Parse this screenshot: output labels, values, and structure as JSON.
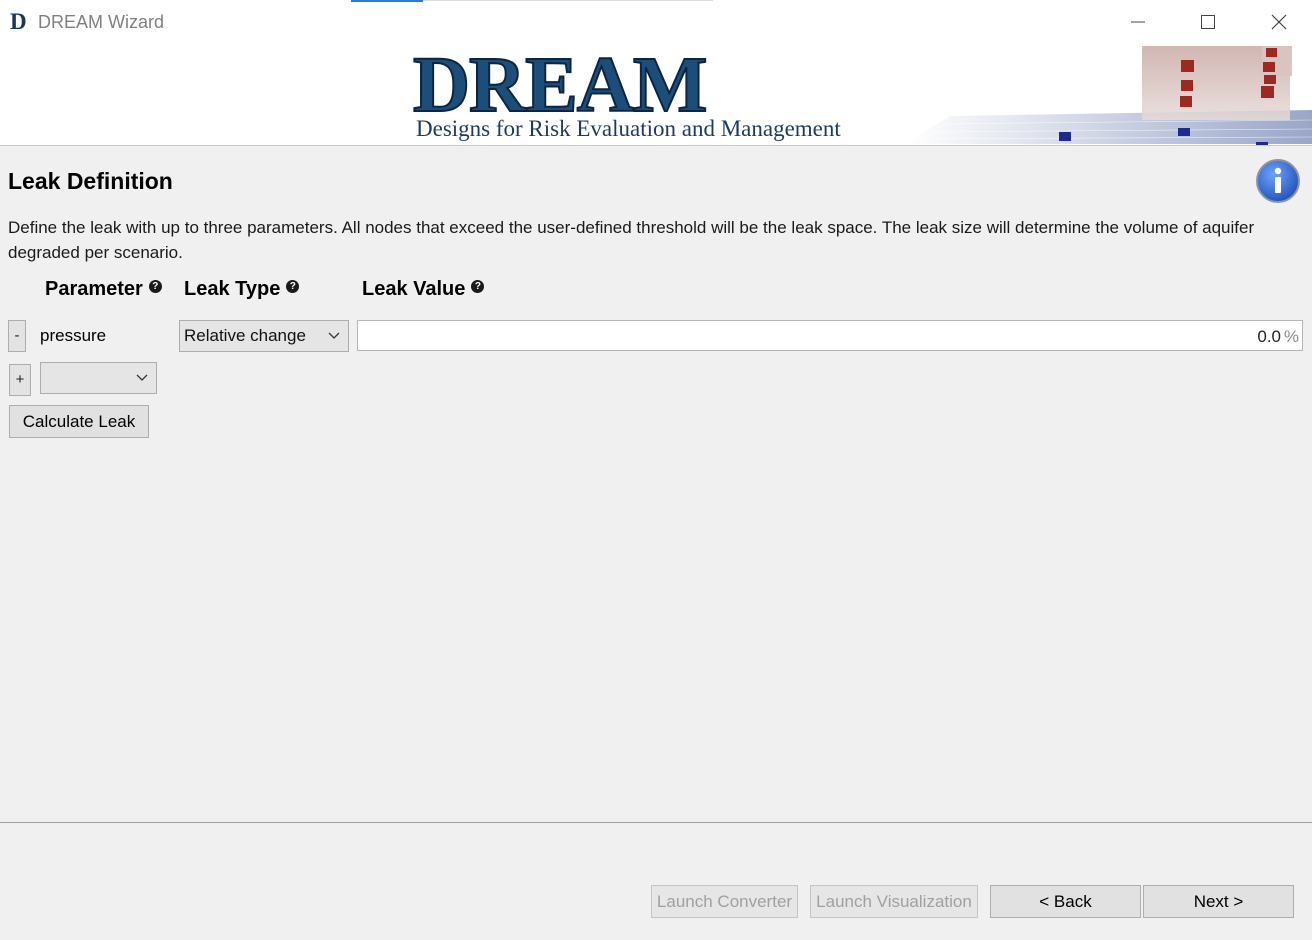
{
  "window": {
    "title": "DREAM Wizard",
    "icon_letter": "D",
    "controls": {
      "minimize": "minimize-icon",
      "maximize": "maximize-icon",
      "close": "close-icon"
    }
  },
  "banner": {
    "logo_text": "DREAM",
    "subtitle": "Designs for Risk Evaluation and Management"
  },
  "page": {
    "title": "Leak Definition",
    "info_icon": "info-icon",
    "description": "Define the leak with up to three parameters. All nodes that exceed the user-defined threshold will be the leak space. The leak size will determine the volume of aquifer degraded per scenario."
  },
  "table": {
    "headers": {
      "parameter": "Parameter",
      "leak_type": "Leak Type",
      "leak_value": "Leak Value"
    },
    "help_glyph": "?",
    "rows": [
      {
        "remove_label": "-",
        "parameter": "pressure",
        "leak_type": "Relative change",
        "leak_value": "0.0",
        "unit": "%"
      }
    ],
    "add_label": "+",
    "add_select_value": ""
  },
  "actions": {
    "calculate_leak": "Calculate Leak"
  },
  "footer": {
    "launch_converter": "Launch Converter",
    "launch_visualization": "Launch Visualization",
    "back": "< Back",
    "next": "Next >"
  },
  "colors": {
    "logo_blue": "#1d3a5f",
    "accent": "#2b7bd0",
    "info_blue": "#1f5fbf"
  }
}
